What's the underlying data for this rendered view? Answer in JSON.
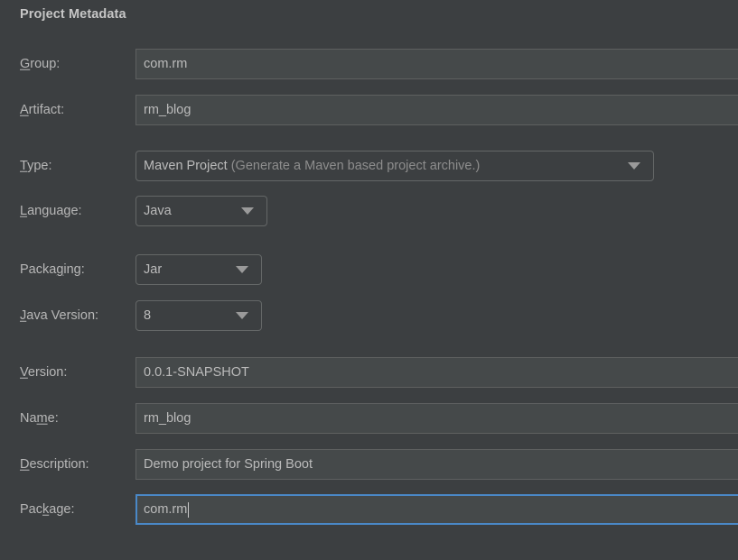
{
  "section": {
    "title": "Project Metadata"
  },
  "theme": {
    "background": "#3c3f41",
    "field_background": "#45494a",
    "field_border": "#5e6060",
    "combo_border": "#646767",
    "text": "#bbbbbb",
    "dim_text": "#8d8d8d",
    "focus_border": "#4a88c7"
  },
  "fields": {
    "group": {
      "label_pre": "",
      "label_mnemonic": "G",
      "label_post": "roup:",
      "value": "com.rm",
      "control": "text-input"
    },
    "artifact": {
      "label_pre": "",
      "label_mnemonic": "A",
      "label_post": "rtifact:",
      "value": "rm_blog",
      "control": "text-input"
    },
    "type": {
      "label_pre": "",
      "label_mnemonic": "T",
      "label_post": "ype:",
      "value": "Maven Project",
      "value_hint": " (Generate a Maven based project archive.)",
      "control": "combo-box",
      "icon": "chevron-down-icon"
    },
    "language": {
      "label_pre": "",
      "label_mnemonic": "L",
      "label_post": "anguage:",
      "value": "Java",
      "control": "combo-box",
      "icon": "chevron-down-icon"
    },
    "packaging": {
      "label_pre": "Packa",
      "label_mnemonic": "g",
      "label_post": "ing:",
      "value": "Jar",
      "control": "combo-box",
      "icon": "chevron-down-icon"
    },
    "java_version": {
      "label_pre": "",
      "label_mnemonic": "J",
      "label_post": "ava Version:",
      "value": "8",
      "control": "combo-box",
      "icon": "chevron-down-icon"
    },
    "version": {
      "label_pre": "",
      "label_mnemonic": "V",
      "label_post": "ersion:",
      "value": "0.0.1-SNAPSHOT",
      "control": "text-input"
    },
    "name": {
      "label_pre": "Na",
      "label_mnemonic": "m",
      "label_post": "e:",
      "value": "rm_blog",
      "control": "text-input"
    },
    "description": {
      "label_pre": "",
      "label_mnemonic": "D",
      "label_post": "escription:",
      "value": "Demo project for Spring Boot",
      "control": "text-input"
    },
    "package": {
      "label_pre": "Pac",
      "label_mnemonic": "k",
      "label_post": "age:",
      "value": "com.rm",
      "control": "text-input",
      "focused": true
    }
  }
}
